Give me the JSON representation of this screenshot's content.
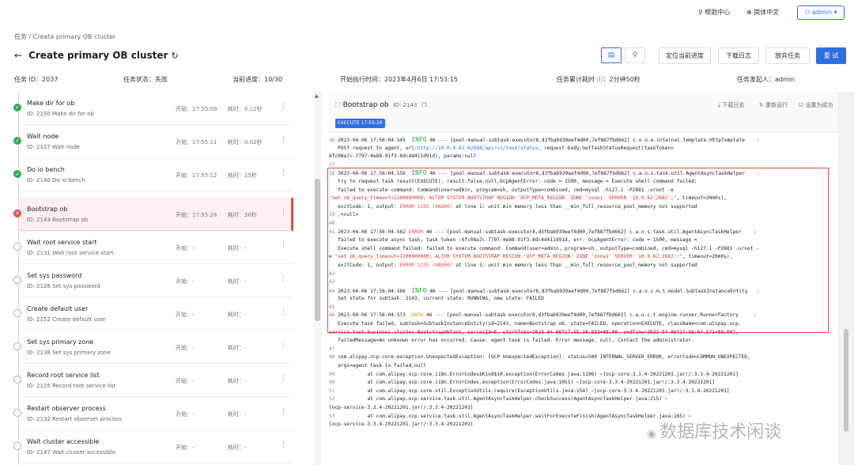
{
  "topbar": {
    "help": "帮助中心",
    "lang": "简体中文",
    "user": "admin"
  },
  "breadcrumb": "任务 / Create primary OB cluster",
  "title": "Create primary OB cluster",
  "toolbar": {
    "locate": "定位当前进度",
    "download": "下载日志",
    "abandon": "放弃任务",
    "retry": "重 试"
  },
  "info": {
    "task_id": "任务 ID：2037",
    "status": "任务状态：失败",
    "progress": "当前进度：10/30",
    "start_time": "开始执行时间：2023年4月6日 17:53:15",
    "elapsed": "任务累计耗时 ⓘ：2分钟50秒",
    "initiator": "任务发起人：admin"
  },
  "steps": [
    {
      "name": "Make dir for ob",
      "id": "ID: 2150  Make dir for ob",
      "start": "开始：17:55:09",
      "dur": "耗时：0.12秒",
      "state": "ok"
    },
    {
      "name": "Wait node",
      "id": "ID: 2127  Wait node",
      "start": "开始：17:55:11",
      "dur": "耗时：0.02秒",
      "state": "ok"
    },
    {
      "name": "Do io bench",
      "id": "ID: 2140  Do io bench",
      "start": "开始：17:55:12",
      "dur": "耗时：15秒",
      "state": "ok"
    },
    {
      "name": "Bootstrap ob",
      "id": "ID: 2143  Bootstrap ob",
      "start": "开始：17:55:28",
      "dur": "耗时：36秒",
      "state": "err"
    },
    {
      "name": "Wait root service start",
      "id": "ID: 2131  Wait root service start",
      "start": "开始：-",
      "dur": "耗时：-",
      "state": "wait"
    },
    {
      "name": "Set sys password",
      "id": "ID: 2128  Set sys password",
      "start": "开始：-",
      "dur": "耗时：-",
      "state": "wait"
    },
    {
      "name": "Create default user",
      "id": "ID: 2152  Create default user",
      "start": "开始：-",
      "dur": "耗时：-",
      "state": "wait"
    },
    {
      "name": "Set sys primary zone",
      "id": "ID: 2138  Set sys primary zone",
      "start": "开始：-",
      "dur": "耗时：-",
      "state": "wait"
    },
    {
      "name": "Record root service list",
      "id": "ID: 2125  Record root service list",
      "start": "开始：-",
      "dur": "耗时：-",
      "state": "wait"
    },
    {
      "name": "Restart observer process",
      "id": "ID: 2132  Restart observer process",
      "start": "开始：-",
      "dur": "耗时：-",
      "state": "wait"
    },
    {
      "name": "Wait cluster accessible",
      "id": "ID: 2147  Wait cluster accessible",
      "start": "开始：-",
      "dur": "耗时：-",
      "state": "wait"
    }
  ],
  "detail": {
    "title": "Bootstrap ob",
    "id": "ID: 2143",
    "badge": "EXECUTE 17:55:28",
    "actions": [
      "下载日志",
      "重新运行",
      "设置为成功"
    ]
  },
  "log_lines": [
    [
      [
        "n",
        "36 "
      ],
      [
        "t",
        "2023-04-06 17:56:04.545  "
      ],
      [
        "info",
        "INFO"
      ],
      [
        "t",
        " 46 --- [pool-manual-subtask-executor8,d3fbab939eef4d00,7ef887fbd662] c.o.o.e.internal.template.HttpTemplate    :"
      ]
    ],
    [
      [
        "t",
        "   POST request to agent, url:"
      ],
      [
        "link",
        "http://10.0.0.62:62888/api/v1/task/status"
      ],
      [
        "t",
        ", request body:GetTaskStatusRequest(taskToken="
      ]
    ],
    [
      [
        "t",
        "6fc08a7c-7797-4e88-91f3-8dc4d411d91d), params:null"
      ]
    ],
    [
      [
        "n",
        "37"
      ]
    ],
    [
      [
        "n",
        "38 "
      ],
      [
        "t",
        "2023-04-06 17:56:04.556  "
      ],
      [
        "info",
        "INFO"
      ],
      [
        "t",
        " 46 --- [pool-manual-subtask-executor8,d3fbab939eef4d00,7ef887fbd662] c.a.o.s.task.util.AgentAsyncTaskHelper    :"
      ]
    ],
    [
      [
        "t",
        "   try to request task result(EXECUTE), result:false,null,OcpAgentError: code = 1500, message = Execute shell command failed:"
      ]
    ],
    [
      [
        "t",
        "   failed to execute command: Command(user=admin, program=sh, outputType=combined, cmd=mysql -h127.1 -P2881 -uroot -e"
      ]
    ],
    [
      [
        "str",
        "\"set ob_query_timeout=1200000000; ALTER SYSTEM BOOTSTRAP REGION 'OCP_META_REGION' ZONE 'zone1' SERVER '10.0.62:2882';\""
      ],
      [
        "t",
        ", timeout=20m0s),"
      ]
    ],
    [
      [
        "t",
        "   exitCode: 1, output: "
      ],
      [
        "err",
        "ERROR 1235 (0A000)"
      ],
      [
        "t",
        " at line 1: unit min memory less than __min_full_resource_pool_memory not supported"
      ]
    ],
    [
      [
        "n",
        "39 "
      ],
      [
        "t",
        ",<null>"
      ]
    ],
    [
      [
        "n",
        "40"
      ]
    ],
    [
      [
        "n",
        "41 "
      ],
      [
        "t",
        "2023-04-06 17:56:04.562 "
      ],
      [
        "err",
        "ERROR"
      ],
      [
        "t",
        " 46 --- [pool-manual-subtask-executor8,d3fbab939eef4d00,7ef887fbd662] c.a.o.s.task.util.AgentAsyncTaskHelper    :"
      ]
    ],
    [
      [
        "t",
        "   failed to execute async task, task token :6fc08a7c-7797-4e88-91f3-8dc4d411d91d, err: OcpAgentError: code = 1500, message ="
      ]
    ],
    [
      [
        "t",
        "   Execute shell command failed: failed to execute command: Command(user=admin, program=sh, outputType=combined, cmd=mysql -h127.1 -P2881 -uroot -"
      ]
    ],
    [
      [
        "t",
        "e "
      ],
      [
        "str",
        "\"set ob_query_timeout=1200000000; ALTER SYSTEM BOOTSTRAP REGION 'OCP_META_REGION' ZONE 'zone1' SERVER '10.0.62:2882';\""
      ],
      [
        "t",
        ", timeout=20m0s),"
      ]
    ],
    [
      [
        "t",
        "   exitCode: 1, output: "
      ],
      [
        "err",
        "ERROR 1235 (0A000)"
      ],
      [
        "t",
        " at line 1: unit min memory less than __min_full_resource_pool_memory not supported"
      ]
    ],
    [
      [
        "n",
        "42"
      ]
    ],
    [
      [
        "n",
        "43"
      ]
    ],
    [
      [
        "n",
        "44 "
      ],
      [
        "t",
        "2023-04-06 17:56:04.566  "
      ],
      [
        "info",
        "INFO"
      ],
      [
        "t",
        " 46 --- [pool-manual-subtask-executor8,d3fbab939eef4d00,7ef887fbd662] c.a.o.c.m.t.model.SubtaskInstanceEntity   :"
      ]
    ],
    [
      [
        "t",
        "   Set state for subtask: 2143, current state: RUNNING, new state: FAILED"
      ]
    ],
    [
      [
        "n",
        "45"
      ]
    ],
    [
      [
        "n",
        "46 "
      ],
      [
        "t",
        "2023-04-06 17:56:04.573  "
      ],
      [
        "warn",
        "WARN"
      ],
      [
        "t",
        " 46 --- [pool-manual-subtask-executor8,d3fbab939eef4d00,7ef887fbd662] c.a.o.c.t.engine.runner.RunnerFactory     :"
      ]
    ],
    [
      [
        "t",
        "   Execute task failed, subtask=SubtaskInstanceEntity(id=2143, name=Bootstrap ob, state=FAILED, operation=EXECUTE, className=com.alipay.ocp."
      ]
    ],
    [
      [
        "t",
        "service.task.business.cluster.BootstrapObTask, seriesId=6, startTime=2023-04-06T17:55:28.832+08:00, endTime=2023-04-06T17:56:04.571+08:00},"
      ]
    ],
    [
      [
        "t",
        "   failedMessage=An unknown error has occurred. Cause: agent task is failed. Error message: null. Contact the administrator."
      ]
    ],
    [
      [
        "n",
        "47"
      ]
    ],
    [
      [
        "n",
        "48 "
      ],
      [
        "t",
        "com.alipay.ocp.core.exception.UnexpectedException: [OCP UnexpectedException]: status=500 INTERNAL_SERVER_ERROR, errorCode=COMMON_UNEXPECTED,"
      ]
    ],
    [
      [
        "t",
        "   args=agent task is failed,null"
      ]
    ],
    [
      [
        "n",
        "49 "
      ],
      [
        "t",
        "          at com.alipay.ocp.core.i18n.ErrorCodes$Kind$10.exception(ErrorCodes.java:1196) ~[ocp-core-3.3.4-20221201.jar!/:3.3.4-20221201]"
      ]
    ],
    [
      [
        "n",
        "50 "
      ],
      [
        "t",
        "          at com.alipay.ocp.core.i18n.ErrorCodes.exception(ErrorCodes.java:1051) ~[ocp-core-3.3.4-20221201.jar!/:3.3.4-20221201]"
      ]
    ],
    [
      [
        "n",
        "51 "
      ],
      [
        "t",
        "          at com.alipay.ocp.core.util.ExceptionUtils.require(ExceptionUtils.java:154) ~[ocp-core-3.3.4-20221201.jar!/:3.3.4-20221201]"
      ]
    ],
    [
      [
        "n",
        "52 "
      ],
      [
        "t",
        "          at com.alipay.ocp.service.task.util.AgentAsyncTaskHelper.checkSuccess(AgentAsyncTaskHelper.java:215) ~"
      ]
    ],
    [
      [
        "t",
        "[ocp-service-3.3.4-20221201.jar!/:3.3.4-20221201]"
      ]
    ],
    [
      [
        "n",
        "53 "
      ],
      [
        "t",
        "          at com.alipay.ocp.service.task.util.AgentAsyncTaskHelper.waitForExecuteFinish(AgentAsyncTaskHelper.java:165) ~"
      ]
    ],
    [
      [
        "t",
        "[ocp-service-3.3.4-20221201.jar!/:3.3.4-20221201]"
      ]
    ]
  ],
  "watermark": "数据库技术闲谈"
}
